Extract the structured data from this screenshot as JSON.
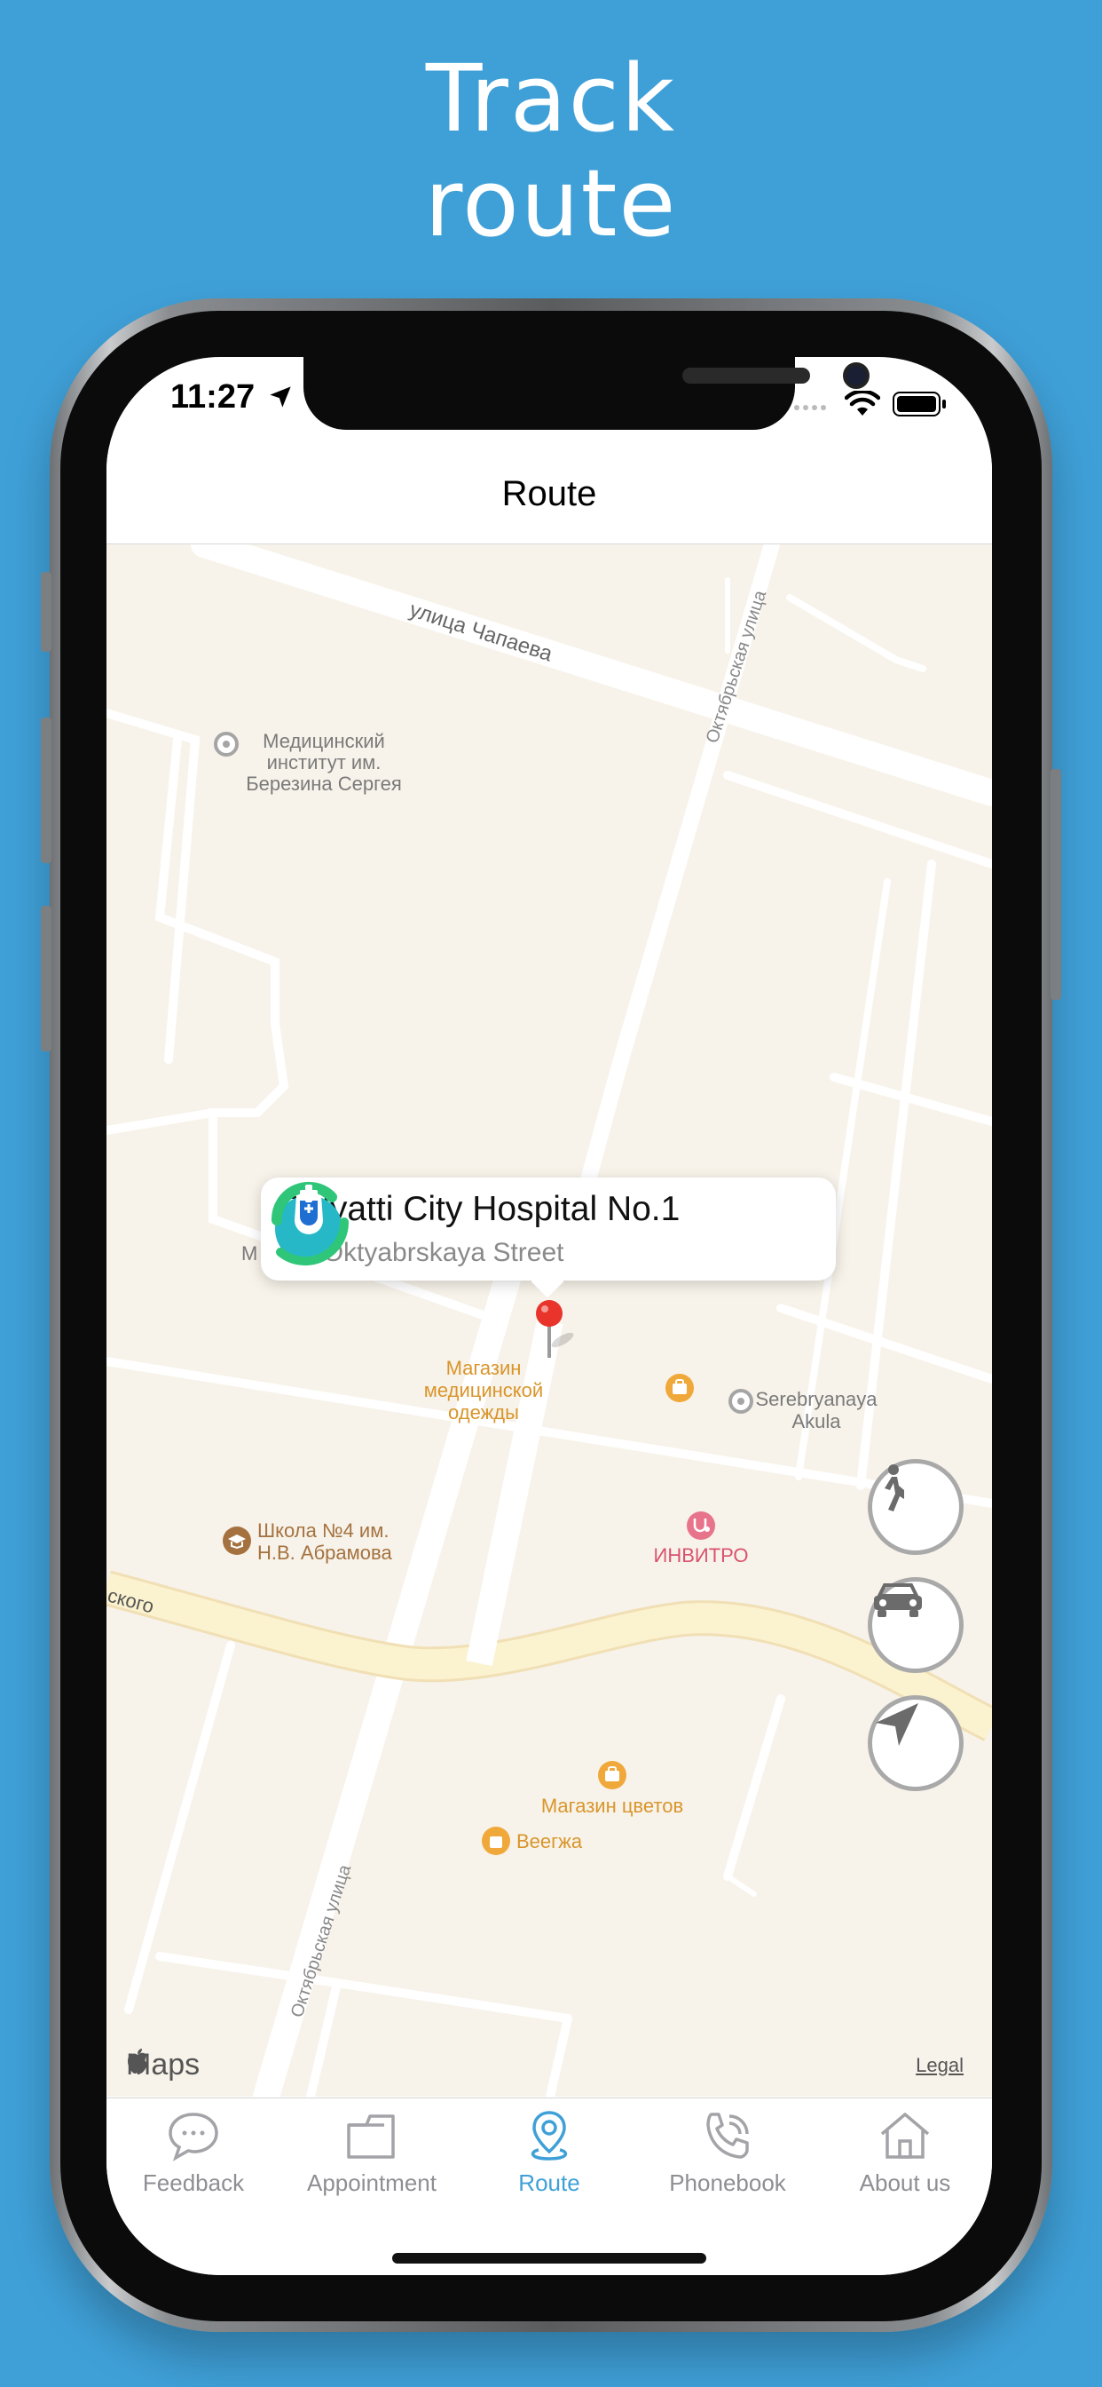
{
  "headline": {
    "line1": "Track",
    "line2": "route"
  },
  "status_bar": {
    "time": "11:27"
  },
  "nav": {
    "title": "Route"
  },
  "map": {
    "streets": [
      {
        "label": "улица Чапаева"
      },
      {
        "label": "Октябрьская улица"
      },
      {
        "label": "Октябрьская улица"
      },
      {
        "label": "ского"
      }
    ],
    "pois": [
      {
        "lines": [
          "Медицинский",
          "институт им.",
          "Березина Сергея"
        ]
      },
      {
        "lines": [
          "М"
        ]
      },
      {
        "lines": [
          "Магазин",
          "медицинской",
          "одежды"
        ]
      },
      {
        "lines": [
          "Serebryanaya",
          "Akula"
        ]
      },
      {
        "lines": [
          "Школа №4 им.",
          "Н.В. Абрамова"
        ]
      },
      {
        "lines": [
          "ИНВИТРО"
        ]
      },
      {
        "lines": [
          "Магазин цветов"
        ]
      },
      {
        "lines": [
          "Веегжа"
        ]
      }
    ],
    "callout": {
      "title": "Tolyatti City Hospital No.1",
      "subtitle": "68 Oktyabrskaya Street"
    },
    "attribution": {
      "brand": "Maps",
      "legal": "Legal"
    },
    "buttons": [
      {
        "icon": "walk-icon"
      },
      {
        "icon": "car-icon"
      },
      {
        "icon": "location-arrow-icon"
      }
    ]
  },
  "tabs": [
    {
      "label": "Feedback",
      "icon": "chat-bubble-icon",
      "active": false
    },
    {
      "label": "Appointment",
      "icon": "folder-icon",
      "active": false
    },
    {
      "label": "Route",
      "icon": "map-pin-icon",
      "active": true
    },
    {
      "label": "Phonebook",
      "icon": "phone-icon",
      "active": false
    },
    {
      "label": "About us",
      "icon": "house-icon",
      "active": false
    }
  ],
  "colors": {
    "background": "#3fa0d8",
    "accent": "#3fa0d8",
    "pin": "#e8342b",
    "poi_orange": "#d9952a",
    "poi_pink": "#d9536e",
    "poi_brown": "#a5723f",
    "map_bg": "#f7f3ea",
    "major_road": "#fbf3cf"
  }
}
